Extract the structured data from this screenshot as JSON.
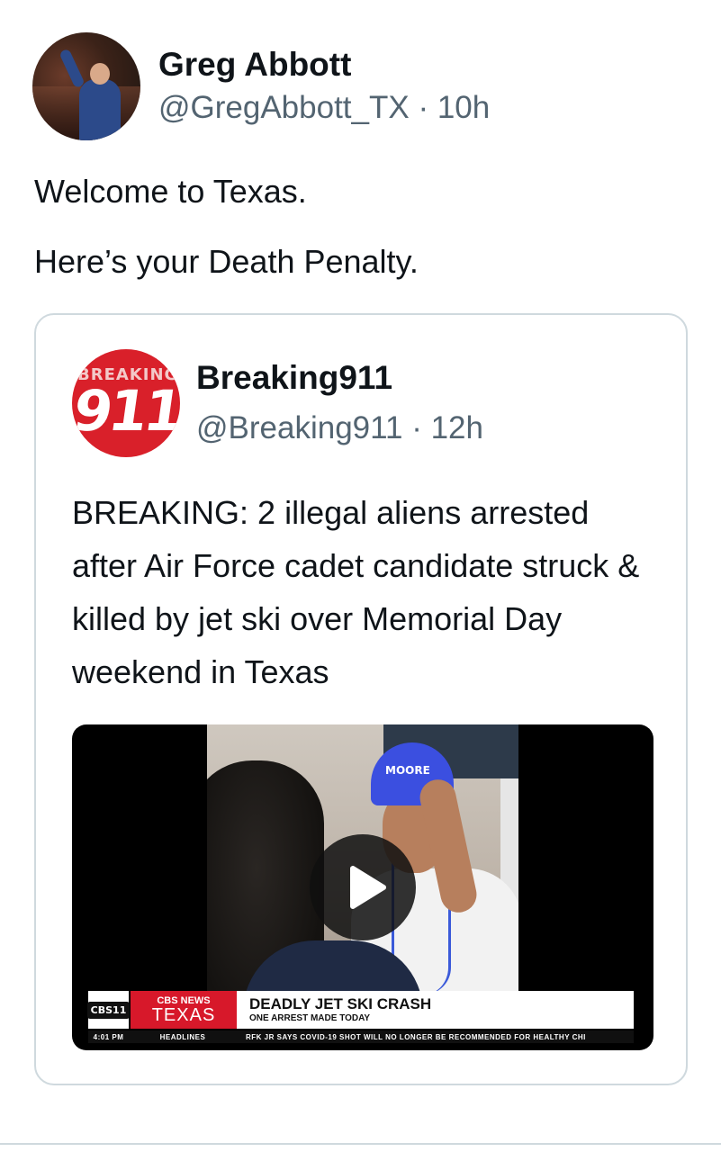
{
  "tweet": {
    "author_name": "Greg Abbott",
    "author_handle": "@GregAbbott_TX",
    "separator": "·",
    "time": "10h",
    "text_line1": "Welcome to Texas.",
    "text_line2": "Here’s your Death Penalty."
  },
  "quoted_tweet": {
    "author_name": "Breaking911",
    "author_handle": "@Breaking911",
    "separator": "·",
    "time": "12h",
    "avatar_text_top": "BREAKING",
    "avatar_text_number": "911",
    "text": "BREAKING: 2 illegal aliens arrested after Air Force cadet candidate struck & killed by jet ski over Memorial Day weekend in Texas"
  },
  "video": {
    "cap_label": "MOORE",
    "channel_logo": "CBS11",
    "network_top": "CBS NEWS",
    "network_bottom": "TEXAS",
    "headline": "DEADLY JET SKI CRASH",
    "subheadline": "ONE ARREST MADE TODAY",
    "ticker_time": "4:01 PM",
    "ticker_label": "HEADLINES",
    "ticker_text": "RFK JR SAYS COVID-19 SHOT WILL NO LONGER BE RECOMMENDED FOR HEALTHY CHI"
  },
  "icons": {
    "play": "play-icon"
  },
  "colors": {
    "text_primary": "#0f1419",
    "text_secondary": "#536471",
    "border": "#cfd9de",
    "cbs_red": "#d7182a",
    "breaking_red": "#d9202a"
  }
}
